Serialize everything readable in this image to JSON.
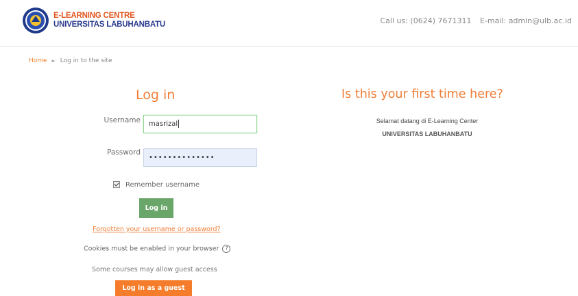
{
  "header": {
    "logo_icon": "university-seal-icon",
    "brand_line1": "E-LEARNING CENTRE",
    "brand_line2": "UNIVERSITAS LABUHANBATU",
    "contact_phone": "Call us: (0624) 7671311",
    "contact_email": "E-mail: admin@ulb.ac.id"
  },
  "breadcrumb": {
    "home": "Home",
    "separator_icon": "triangle-right-icon",
    "current": "Log in to the site"
  },
  "login": {
    "title": "Log in",
    "username_label": "Username",
    "username_value": "masrizal",
    "password_label": "Password",
    "password_value": "••••••••••••••",
    "remember_label": "Remember username",
    "remember_checked": true,
    "submit_label": "Log in",
    "forgot_link": "Forgotten your username or password?",
    "cookies_text": "Cookies must be enabled in your browser",
    "guest_note": "Some courses may allow guest access",
    "guest_button": "Log in as a guest"
  },
  "first_time": {
    "title": "Is this your first time here?",
    "welcome_line1": "Selamat datang di E-Learning Center",
    "welcome_line2": "UNIVERSITAS LABUHANBATU"
  },
  "colors": {
    "accent_orange": "#f07e38",
    "brand_blue": "#2a3a8e",
    "login_green": "#6aa56a",
    "guest_orange": "#f47c2a"
  }
}
